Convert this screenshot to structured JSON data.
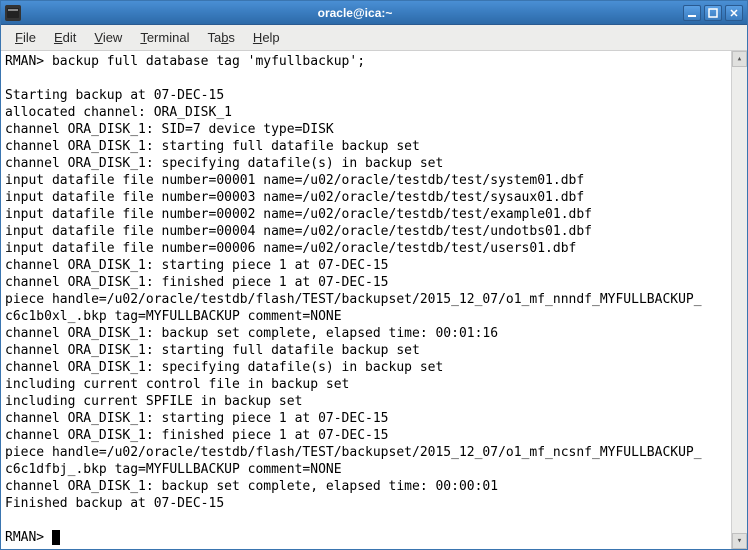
{
  "window": {
    "title": "oracle@ica:~"
  },
  "menu": {
    "file": "File",
    "edit": "Edit",
    "view": "View",
    "terminal": "Terminal",
    "tabs": "Tabs",
    "help": "Help"
  },
  "terminal": {
    "lines": [
      "RMAN> backup full database tag 'myfullbackup';",
      "",
      "Starting backup at 07-DEC-15",
      "allocated channel: ORA_DISK_1",
      "channel ORA_DISK_1: SID=7 device type=DISK",
      "channel ORA_DISK_1: starting full datafile backup set",
      "channel ORA_DISK_1: specifying datafile(s) in backup set",
      "input datafile file number=00001 name=/u02/oracle/testdb/test/system01.dbf",
      "input datafile file number=00003 name=/u02/oracle/testdb/test/sysaux01.dbf",
      "input datafile file number=00002 name=/u02/oracle/testdb/test/example01.dbf",
      "input datafile file number=00004 name=/u02/oracle/testdb/test/undotbs01.dbf",
      "input datafile file number=00006 name=/u02/oracle/testdb/test/users01.dbf",
      "channel ORA_DISK_1: starting piece 1 at 07-DEC-15",
      "channel ORA_DISK_1: finished piece 1 at 07-DEC-15",
      "piece handle=/u02/oracle/testdb/flash/TEST/backupset/2015_12_07/o1_mf_nnndf_MYFULLBACKUP_",
      "c6c1b0xl_.bkp tag=MYFULLBACKUP comment=NONE",
      "channel ORA_DISK_1: backup set complete, elapsed time: 00:01:16",
      "channel ORA_DISK_1: starting full datafile backup set",
      "channel ORA_DISK_1: specifying datafile(s) in backup set",
      "including current control file in backup set",
      "including current SPFILE in backup set",
      "channel ORA_DISK_1: starting piece 1 at 07-DEC-15",
      "channel ORA_DISK_1: finished piece 1 at 07-DEC-15",
      "piece handle=/u02/oracle/testdb/flash/TEST/backupset/2015_12_07/o1_mf_ncsnf_MYFULLBACKUP_",
      "c6c1dfbj_.bkp tag=MYFULLBACKUP comment=NONE",
      "channel ORA_DISK_1: backup set complete, elapsed time: 00:00:01",
      "Finished backup at 07-DEC-15",
      "",
      "RMAN> "
    ]
  }
}
